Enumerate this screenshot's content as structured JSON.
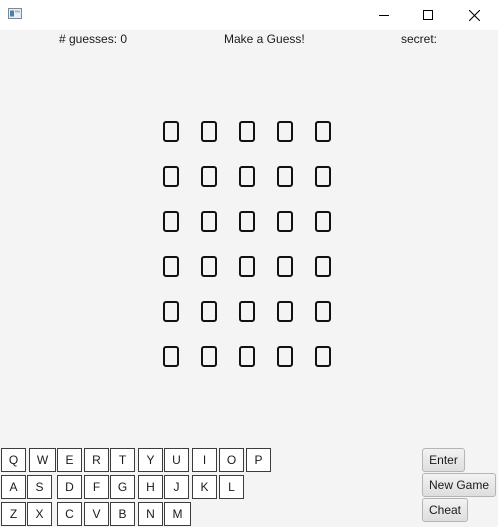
{
  "window": {
    "title": "",
    "minimize_icon": "minimize-icon",
    "maximize_icon": "maximize-icon",
    "close_icon": "close-icon"
  },
  "status": {
    "guesses_label": "# guesses: 0",
    "message": "Make a Guess!",
    "secret_label": "secret:"
  },
  "board": {
    "rows": [
      [
        "",
        "",
        "",
        "",
        ""
      ],
      [
        "",
        "",
        "",
        "",
        ""
      ],
      [
        "",
        "",
        "",
        "",
        ""
      ],
      [
        "",
        "",
        "",
        "",
        ""
      ],
      [
        "",
        "",
        "",
        "",
        ""
      ],
      [
        "",
        "",
        "",
        "",
        ""
      ]
    ]
  },
  "keyboard": {
    "row1": [
      "Q",
      "W",
      "E",
      "R",
      "T",
      "Y",
      "U",
      "I",
      "O",
      "P"
    ],
    "row2": [
      "A",
      "S",
      "D",
      "F",
      "G",
      "H",
      "J",
      "K",
      "L"
    ],
    "row3": [
      "Z",
      "X",
      "C",
      "V",
      "B",
      "N",
      "M"
    ]
  },
  "actions": {
    "enter_label": "Enter",
    "new_game_label": "New Game",
    "cheat_label": "Cheat"
  }
}
